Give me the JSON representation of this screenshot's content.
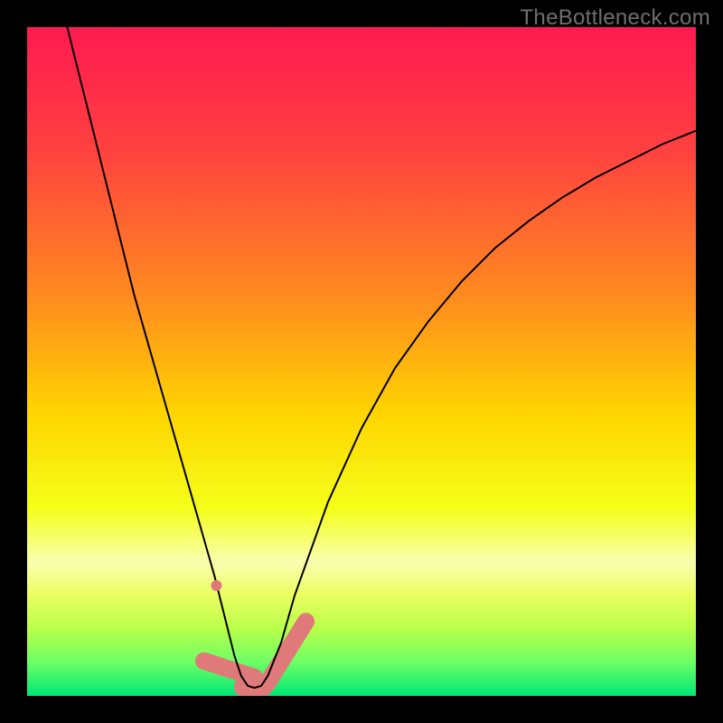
{
  "watermark": "TheBottleneck.com",
  "chart_data": {
    "type": "line",
    "title": "",
    "xlabel": "",
    "ylabel": "",
    "xlim": [
      0,
      100
    ],
    "ylim": [
      0,
      100
    ],
    "grid": false,
    "legend": "none",
    "background": {
      "type": "vertical-gradient",
      "stops": [
        {
          "pos": 0.0,
          "color": "#ff1a51"
        },
        {
          "pos": 0.18,
          "color": "#ff4040"
        },
        {
          "pos": 0.4,
          "color": "#ff8a20"
        },
        {
          "pos": 0.58,
          "color": "#ffd500"
        },
        {
          "pos": 0.72,
          "color": "#f5ff1a"
        },
        {
          "pos": 0.8,
          "color": "#f8ffb0"
        },
        {
          "pos": 0.85,
          "color": "#eaff60"
        },
        {
          "pos": 0.9,
          "color": "#b8ff4a"
        },
        {
          "pos": 0.95,
          "color": "#6cff65"
        },
        {
          "pos": 1.0,
          "color": "#00e676"
        }
      ]
    },
    "series": [
      {
        "name": "bottleneck-curve",
        "color": "#000000",
        "width": 2,
        "x": [
          6,
          8,
          10,
          12,
          14,
          16,
          18,
          20,
          22,
          24,
          26,
          28,
          29,
          30,
          31,
          32,
          33,
          34,
          35,
          36,
          38,
          40,
          45,
          50,
          55,
          60,
          65,
          70,
          75,
          80,
          85,
          90,
          95,
          100
        ],
        "y": [
          100,
          92,
          84,
          76,
          68,
          60,
          53,
          46,
          39,
          32,
          25,
          18,
          14,
          10,
          6,
          3,
          1.5,
          1.2,
          1.5,
          3,
          8,
          15,
          29,
          40,
          49,
          56,
          62,
          67,
          71,
          74.5,
          77.5,
          80,
          82.5,
          84.5
        ]
      }
    ],
    "markers": [
      {
        "name": "marker-dot-left",
        "shape": "circle",
        "color": "#e07a7a",
        "x": 28.3,
        "y": 16.5,
        "r": 6
      },
      {
        "name": "marker-blob-left",
        "shape": "rounded-rect",
        "color": "#e07a7a",
        "x": 30.2,
        "y": 4.0,
        "w": 2.6,
        "h": 10.5,
        "rotate": -72
      },
      {
        "name": "marker-blob-bottom",
        "shape": "rounded-rect",
        "color": "#e07a7a",
        "x": 33.8,
        "y": 1.3,
        "w": 5.8,
        "h": 2.8
      },
      {
        "name": "marker-blob-right",
        "shape": "rounded-rect",
        "color": "#e07a7a",
        "x": 38.8,
        "y": 6.5,
        "w": 2.6,
        "h": 13.5,
        "rotate": 32
      }
    ]
  }
}
